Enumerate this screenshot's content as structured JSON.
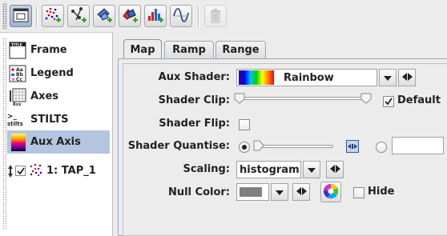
{
  "sidebar": {
    "items": [
      {
        "label": "Frame",
        "icon": "frame-icon"
      },
      {
        "label": "Legend",
        "icon": "legend-icon"
      },
      {
        "label": "Axes",
        "icon": "axes-icon"
      },
      {
        "label": "STILTS",
        "icon": "stilts-icon"
      },
      {
        "label": "Aux Axis",
        "icon": "aux-axis-icon",
        "selected": true
      },
      {
        "label": "1: TAP_1",
        "icon": "scatter-layer-icon",
        "checked": true
      }
    ]
  },
  "tabs": [
    {
      "label": "Map",
      "active": true
    },
    {
      "label": "Ramp"
    },
    {
      "label": "Range"
    }
  ],
  "form": {
    "aux_shader_label": "Aux Shader:",
    "aux_shader_value": "Rainbow",
    "shader_clip_label": "Shader Clip:",
    "default_label": "Default",
    "default_checked": true,
    "shader_flip_label": "Shader Flip:",
    "shader_flip_checked": false,
    "shader_quantise_label": "Shader Quantise:",
    "quantise_slider_selected": true,
    "quantise_text_value": "",
    "scaling_label": "Scaling:",
    "scaling_value": "histogram",
    "null_color_label": "Null Color:",
    "null_color_value": "#808080",
    "hide_label": "Hide",
    "hide_checked": false
  },
  "colors": {
    "selection": "#b4c5df",
    "rainbow": [
      "#3b0077",
      "#0000ff",
      "#00c0ff",
      "#00d000",
      "#ffff00",
      "#ff8000",
      "#ff0000"
    ]
  }
}
